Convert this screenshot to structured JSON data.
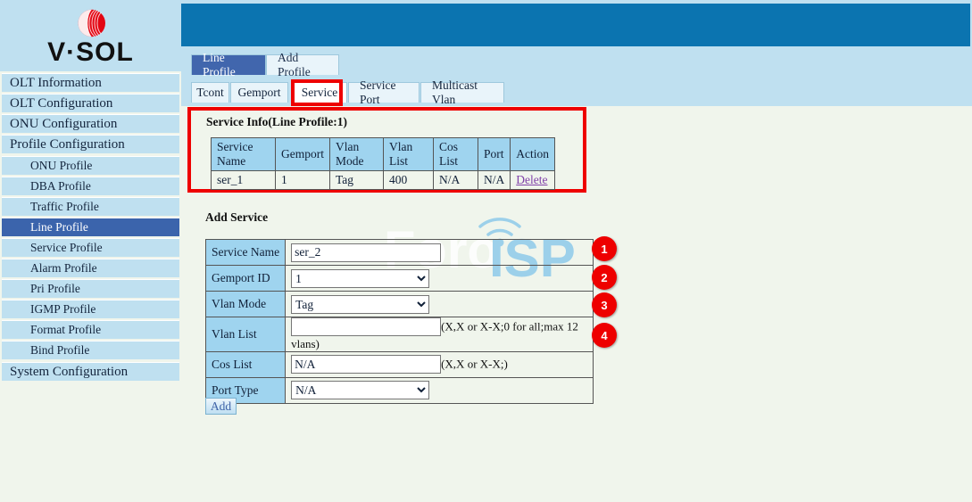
{
  "brand": {
    "logo_text": "V·SOL",
    "logo_icon": "vsol-sphere-logo"
  },
  "sidebar": {
    "items": [
      {
        "label": "OLT Information",
        "level": 1,
        "active": false
      },
      {
        "label": "OLT Configuration",
        "level": 1,
        "active": false
      },
      {
        "label": "ONU Configuration",
        "level": 1,
        "active": false
      },
      {
        "label": "Profile Configuration",
        "level": 1,
        "active": false
      },
      {
        "label": "ONU Profile",
        "level": 2,
        "active": false
      },
      {
        "label": "DBA Profile",
        "level": 2,
        "active": false
      },
      {
        "label": "Traffic Profile",
        "level": 2,
        "active": false
      },
      {
        "label": "Line Profile",
        "level": 2,
        "active": true
      },
      {
        "label": "Service Profile",
        "level": 2,
        "active": false
      },
      {
        "label": "Alarm Profile",
        "level": 2,
        "active": false
      },
      {
        "label": "Pri Profile",
        "level": 2,
        "active": false
      },
      {
        "label": "IGMP Profile",
        "level": 2,
        "active": false
      },
      {
        "label": "Format Profile",
        "level": 2,
        "active": false
      },
      {
        "label": "Bind Profile",
        "level": 2,
        "active": false
      },
      {
        "label": "System Configuration",
        "level": 1,
        "active": false
      }
    ]
  },
  "tabs_primary": [
    {
      "label": "Line Profile",
      "selected": true
    },
    {
      "label": "Add Profile",
      "selected": false
    }
  ],
  "tabs_secondary": [
    {
      "label": "Tcont",
      "selected": false
    },
    {
      "label": "Gemport",
      "selected": false
    },
    {
      "label": "Service",
      "selected": true
    },
    {
      "label": "Service Port",
      "selected": false
    },
    {
      "label": "Multicast Vlan",
      "selected": false
    }
  ],
  "service_info": {
    "title": "Service Info(Line Profile:1)",
    "columns": [
      "Service Name",
      "Gemport",
      "Vlan Mode",
      "Vlan List",
      "Cos List",
      "Port",
      "Action"
    ],
    "rows": [
      {
        "service_name": "ser_1",
        "gemport": "1",
        "vlan_mode": "Tag",
        "vlan_list": "400",
        "cos_list": "N/A",
        "port": "N/A",
        "action": "Delete"
      }
    ]
  },
  "add_service": {
    "title": "Add Service",
    "fields": {
      "service_name": {
        "label": "Service Name",
        "value": "ser_2",
        "placeholder": ""
      },
      "gemport_id": {
        "label": "Gemport ID",
        "value": "1"
      },
      "vlan_mode": {
        "label": "Vlan Mode",
        "value": "Tag"
      },
      "vlan_list": {
        "label": "Vlan List",
        "value": "",
        "placeholder": "",
        "hint": "(X,X or X-X;0 for all;max 12 vlans)"
      },
      "cos_list": {
        "label": "Cos List",
        "value": "N/A",
        "hint": "(X,X or X-X;)"
      },
      "port_type": {
        "label": "Port Type",
        "value": "N/A"
      }
    },
    "submit_label": "Add"
  },
  "annotations": {
    "badges": [
      "1",
      "2",
      "3",
      "4"
    ],
    "highlight_color": "#ee0000"
  },
  "watermark": {
    "text_light": "Foro",
    "text_blue": "ISP",
    "icon": "wifi-signal-icon"
  },
  "colors": {
    "header_blue": "#0b74b0",
    "sidebar_blue": "#bfe0f0",
    "active_nav": "#3b64ac",
    "table_header": "#9fd4ef",
    "page_bg": "#f0f5ec",
    "accent_red": "#ee0000",
    "link_purple": "#7f3fa8"
  }
}
